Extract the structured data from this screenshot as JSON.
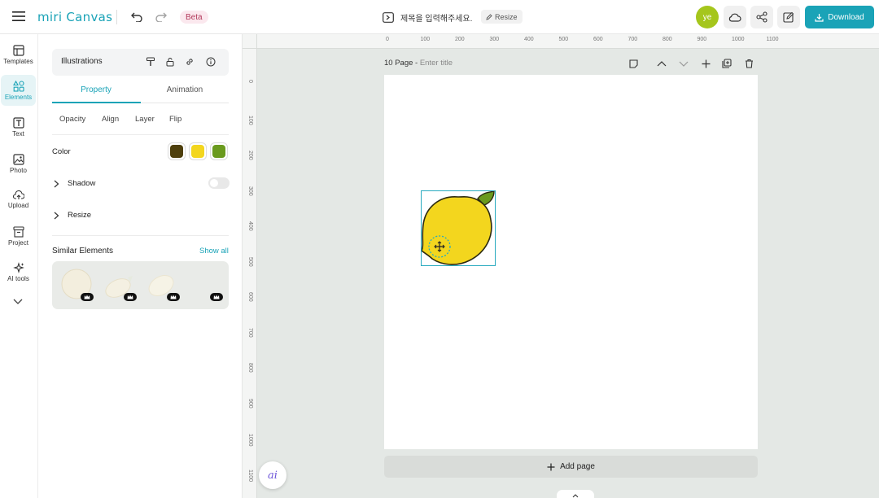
{
  "header": {
    "logo_text": "miri Canvas",
    "beta_label": "Beta",
    "document_title": "제목을 입력해주세요.",
    "resize_label": "Resize",
    "avatar_initials": "ye",
    "download_label": "Download"
  },
  "rail": {
    "items": [
      {
        "label": "Templates",
        "icon": "template-icon"
      },
      {
        "label": "Elements",
        "icon": "elements-icon"
      },
      {
        "label": "Text",
        "icon": "text-icon"
      },
      {
        "label": "Photo",
        "icon": "photo-icon"
      },
      {
        "label": "Upload",
        "icon": "upload-icon"
      },
      {
        "label": "Project",
        "icon": "project-icon"
      },
      {
        "label": "AI tools",
        "icon": "sparkle-icon"
      }
    ],
    "active": "Elements"
  },
  "panel": {
    "header_title": "Illustrations",
    "tabs": [
      "Property",
      "Animation"
    ],
    "subtabs": [
      "Opacity",
      "Align",
      "Layer",
      "Flip"
    ],
    "color_label": "Color",
    "colors": [
      "#4e3f0c",
      "#f3d61e",
      "#6a9a1e"
    ],
    "shadow_label": "Shadow",
    "resize_label": "Resize",
    "similar_title": "Similar Elements",
    "show_all_label": "Show all"
  },
  "canvas": {
    "ruler_top_ticks": [
      "0",
      "100",
      "200",
      "300",
      "400",
      "500",
      "600",
      "700",
      "800",
      "900",
      "1000",
      "1100"
    ],
    "ruler_left_ticks": [
      "0",
      "100",
      "200",
      "300",
      "400",
      "500",
      "600",
      "700",
      "800",
      "900",
      "1000",
      "1100"
    ],
    "page_label": "10 Page - ",
    "page_title_placeholder": "Enter title",
    "add_page_label": "Add page",
    "ai_label": "ai"
  }
}
